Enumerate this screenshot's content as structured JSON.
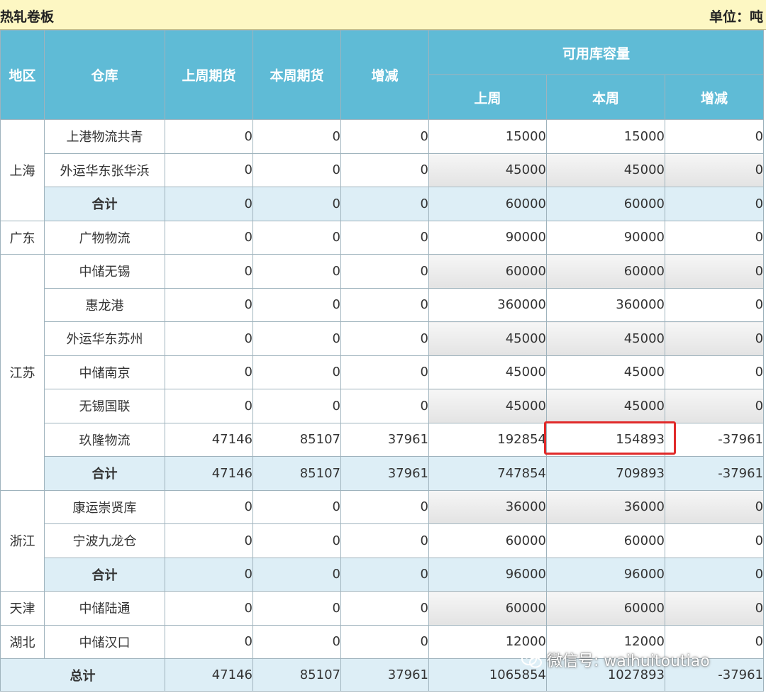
{
  "title": {
    "left": "热轧卷板",
    "right": "单位：吨"
  },
  "headers": {
    "region": "地区",
    "warehouse": "仓库",
    "last_futures": "上周期货",
    "this_futures": "本周期货",
    "change": "增减",
    "capacity": "可用库容量",
    "cap_last": "上周",
    "cap_this": "本周",
    "cap_change": "增减"
  },
  "rows": [
    {
      "region": "上海",
      "warehouse": "上港物流共青",
      "v": [
        "0",
        "0",
        "0",
        "15000",
        "15000",
        "0"
      ]
    },
    {
      "warehouse": "外运华东张华浜",
      "v": [
        "0",
        "0",
        "0",
        "45000",
        "45000",
        "0"
      ]
    },
    {
      "warehouse": "合计",
      "v": [
        "0",
        "0",
        "0",
        "60000",
        "60000",
        "0"
      ]
    },
    {
      "region": "广东",
      "warehouse": "广物物流",
      "v": [
        "0",
        "0",
        "0",
        "90000",
        "90000",
        "0"
      ]
    },
    {
      "region": "江苏",
      "warehouse": "中储无锡",
      "v": [
        "0",
        "0",
        "0",
        "60000",
        "60000",
        "0"
      ]
    },
    {
      "warehouse": "惠龙港",
      "v": [
        "0",
        "0",
        "0",
        "360000",
        "360000",
        "0"
      ]
    },
    {
      "warehouse": "外运华东苏州",
      "v": [
        "0",
        "0",
        "0",
        "45000",
        "45000",
        "0"
      ]
    },
    {
      "warehouse": "中储南京",
      "v": [
        "0",
        "0",
        "0",
        "45000",
        "45000",
        "0"
      ]
    },
    {
      "warehouse": "无锡国联",
      "v": [
        "0",
        "0",
        "0",
        "45000",
        "45000",
        "0"
      ]
    },
    {
      "warehouse": "玖隆物流",
      "v": [
        "47146",
        "85107",
        "37961",
        "192854",
        "154893",
        "-37961"
      ]
    },
    {
      "warehouse": "合计",
      "v": [
        "47146",
        "85107",
        "37961",
        "747854",
        "709893",
        "-37961"
      ]
    },
    {
      "region": "浙江",
      "warehouse": "康运崇贤库",
      "v": [
        "0",
        "0",
        "0",
        "36000",
        "36000",
        "0"
      ]
    },
    {
      "warehouse": "宁波九龙仓",
      "v": [
        "0",
        "0",
        "0",
        "60000",
        "60000",
        "0"
      ]
    },
    {
      "warehouse": "合计",
      "v": [
        "0",
        "0",
        "0",
        "96000",
        "96000",
        "0"
      ]
    },
    {
      "region": "天津",
      "warehouse": "中储陆通",
      "v": [
        "0",
        "0",
        "0",
        "60000",
        "60000",
        "0"
      ]
    },
    {
      "region": "湖北",
      "warehouse": "中储汉口",
      "v": [
        "0",
        "0",
        "0",
        "12000",
        "12000",
        "0"
      ]
    }
  ],
  "total": {
    "label": "总计",
    "v": [
      "47146",
      "85107",
      "37961",
      "1065854",
      "1027893",
      "-37961"
    ]
  },
  "watermark": "微信号: waihuitoutiao",
  "colors": {
    "header_bg": "#5fbbd6",
    "title_bg": "#fdf7c3",
    "subtotal_bg": "#ddeef6",
    "highlight": "#e02a2a"
  }
}
